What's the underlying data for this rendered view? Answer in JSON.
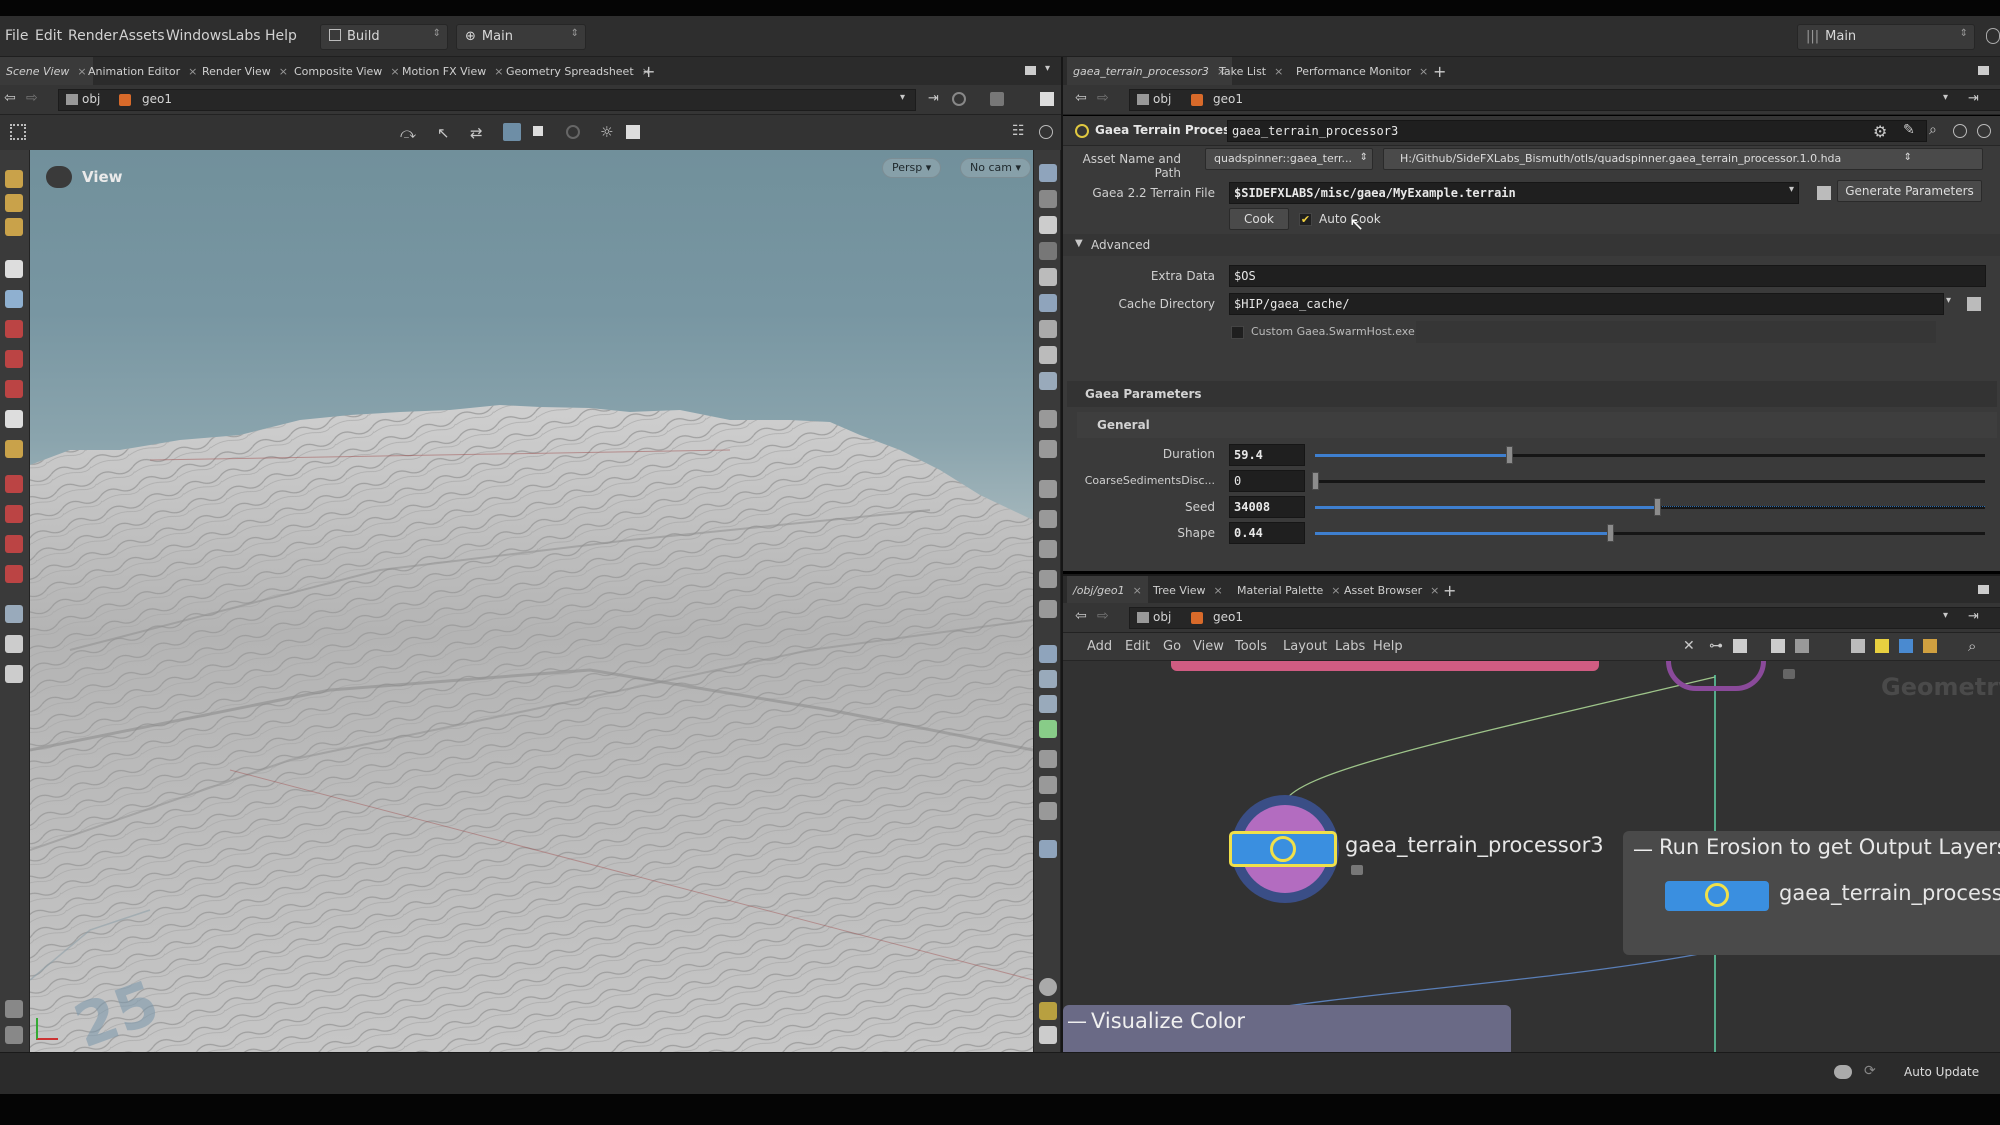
{
  "menubar": {
    "items": [
      "File",
      "Edit",
      "Render",
      "Assets",
      "Windows",
      "Labs",
      "Help"
    ],
    "desktop_dropdown": "Build",
    "context_dropdown": "Main",
    "right_dropdown": "Main"
  },
  "left_pane": {
    "tabs": [
      "Scene View",
      "Animation Editor",
      "Render View",
      "Composite View",
      "Motion FX View",
      "Geometry Spreadsheet"
    ],
    "path": [
      "obj",
      "geo1"
    ],
    "viewport": {
      "title": "View",
      "camera_mode": "Persp",
      "camera": "No cam",
      "corner_number": "25"
    }
  },
  "right_top_pane": {
    "tabs": [
      "gaea_terrain_processor3",
      "Take List",
      "Performance Monitor"
    ],
    "path": [
      "obj",
      "geo1"
    ],
    "node_type": "Gaea Terrain Processor",
    "node_name": "gaea_terrain_processor3",
    "asset_name_label": "Asset Name and Path",
    "asset_name_value": "quadspinner::gaea_terr...",
    "asset_path_value": "H:/Github/SideFXLabs_Bismuth/otls/quadspinner.gaea_terrain_processor.1.0.hda",
    "terrain_file_label": "Gaea 2.2 Terrain File",
    "terrain_file_value": "$SIDEFXLABS/misc/gaea/MyExample.terrain",
    "generate_button": "Generate Parameters",
    "cook_button": "Cook",
    "auto_cook_label": "Auto Cook",
    "auto_cook_checked": true,
    "advanced_label": "Advanced",
    "extra_data_label": "Extra Data",
    "extra_data_value": "$OS",
    "cache_dir_label": "Cache Directory",
    "cache_dir_value": "$HIP/gaea_cache/",
    "custom_swarm_label": "Custom Gaea.SwarmHost.exe",
    "custom_swarm_checked": false,
    "gaea_params_label": "Gaea Parameters",
    "general_label": "General",
    "params": [
      {
        "label": "Duration",
        "value": "59.4",
        "fraction": 0.29
      },
      {
        "label": "CoarseSedimentsDisc...",
        "value": "0",
        "fraction": 0.0
      },
      {
        "label": "Seed",
        "value": "34008",
        "fraction": 0.51
      },
      {
        "label": "Shape",
        "value": "0.44",
        "fraction": 0.44
      }
    ]
  },
  "right_bottom_pane": {
    "tabs": [
      "/obj/geo1",
      "Tree View",
      "Material Palette",
      "Asset Browser"
    ],
    "path": [
      "obj",
      "geo1"
    ],
    "menu": [
      "Add",
      "Edit",
      "Go",
      "View",
      "Tools",
      "Layout",
      "Labs",
      "Help"
    ],
    "network_watermark": "Geometry",
    "nodes": {
      "main_node_label": "gaea_terrain_processor3",
      "box_title": "Run Erosion to get Output Layers",
      "box_node_label": "gaea_terrain_processo",
      "bottom_box_title": "Visualize Color"
    }
  },
  "statusbar": {
    "auto_update": "Auto Update"
  },
  "colors": {
    "accent_blue": "#3e7fcf",
    "node_blue": "#3a8fe0",
    "node_yellow": "#f0e04a",
    "wire_green": "#5fd3a8",
    "visualize_box": "#6a6a86"
  }
}
